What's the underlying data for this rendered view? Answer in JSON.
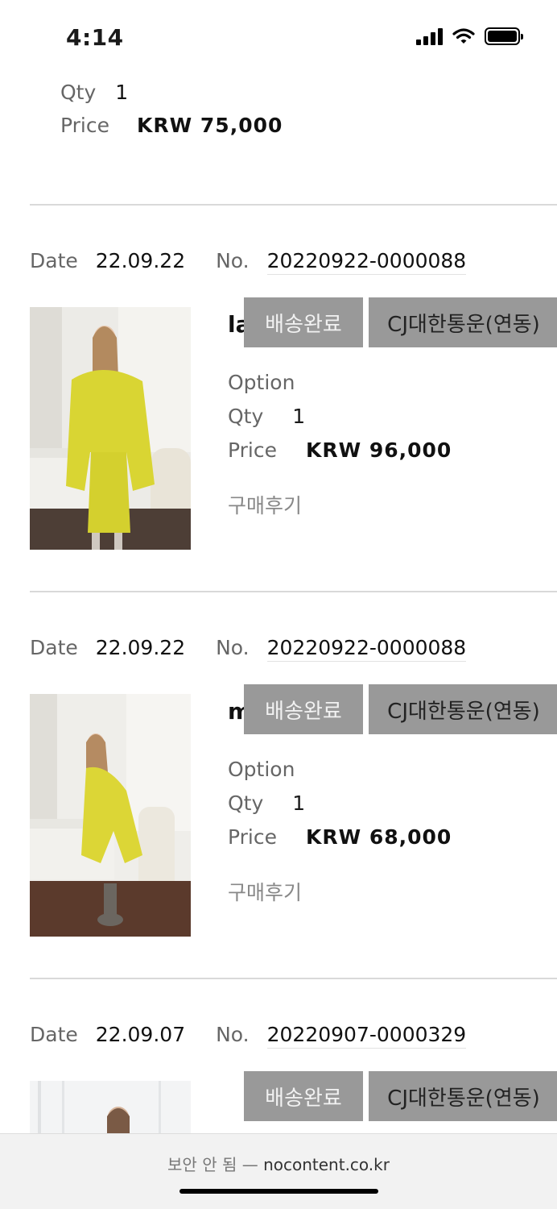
{
  "status_bar": {
    "time": "4:14"
  },
  "top_item": {
    "qty_label": "Qty",
    "qty_value": "1",
    "price_label": "Price",
    "price_value": "KRW 75,000"
  },
  "orders": [
    {
      "date_label": "Date",
      "date": "22.09.22",
      "no_label": "No.",
      "no": "20220922-0000088",
      "name_visible": "la",
      "status_btn": "배송완료",
      "courier_btn": "CJ대한통운(연동)",
      "option_label": "Option",
      "qty_label": "Qty",
      "qty_value": "1",
      "price_label": "Price",
      "price_value": "KRW 96,000",
      "review": "구매후기"
    },
    {
      "date_label": "Date",
      "date": "22.09.22",
      "no_label": "No.",
      "no": "20220922-0000088",
      "name_visible": "m",
      "status_btn": "배송완료",
      "courier_btn": "CJ대한통운(연동)",
      "option_label": "Option",
      "qty_label": "Qty",
      "qty_value": "1",
      "price_label": "Price",
      "price_value": "KRW 68,000",
      "review": "구매후기"
    },
    {
      "date_label": "Date",
      "date": "22.09.07",
      "no_label": "No.",
      "no": "20220907-0000329",
      "status_btn": "배송완료",
      "courier_btn": "CJ대한통운(연동)"
    }
  ],
  "browser_bar": {
    "insecure_label": "보안 안 됨",
    "separator": "—",
    "domain": "nocontent.co.kr"
  }
}
